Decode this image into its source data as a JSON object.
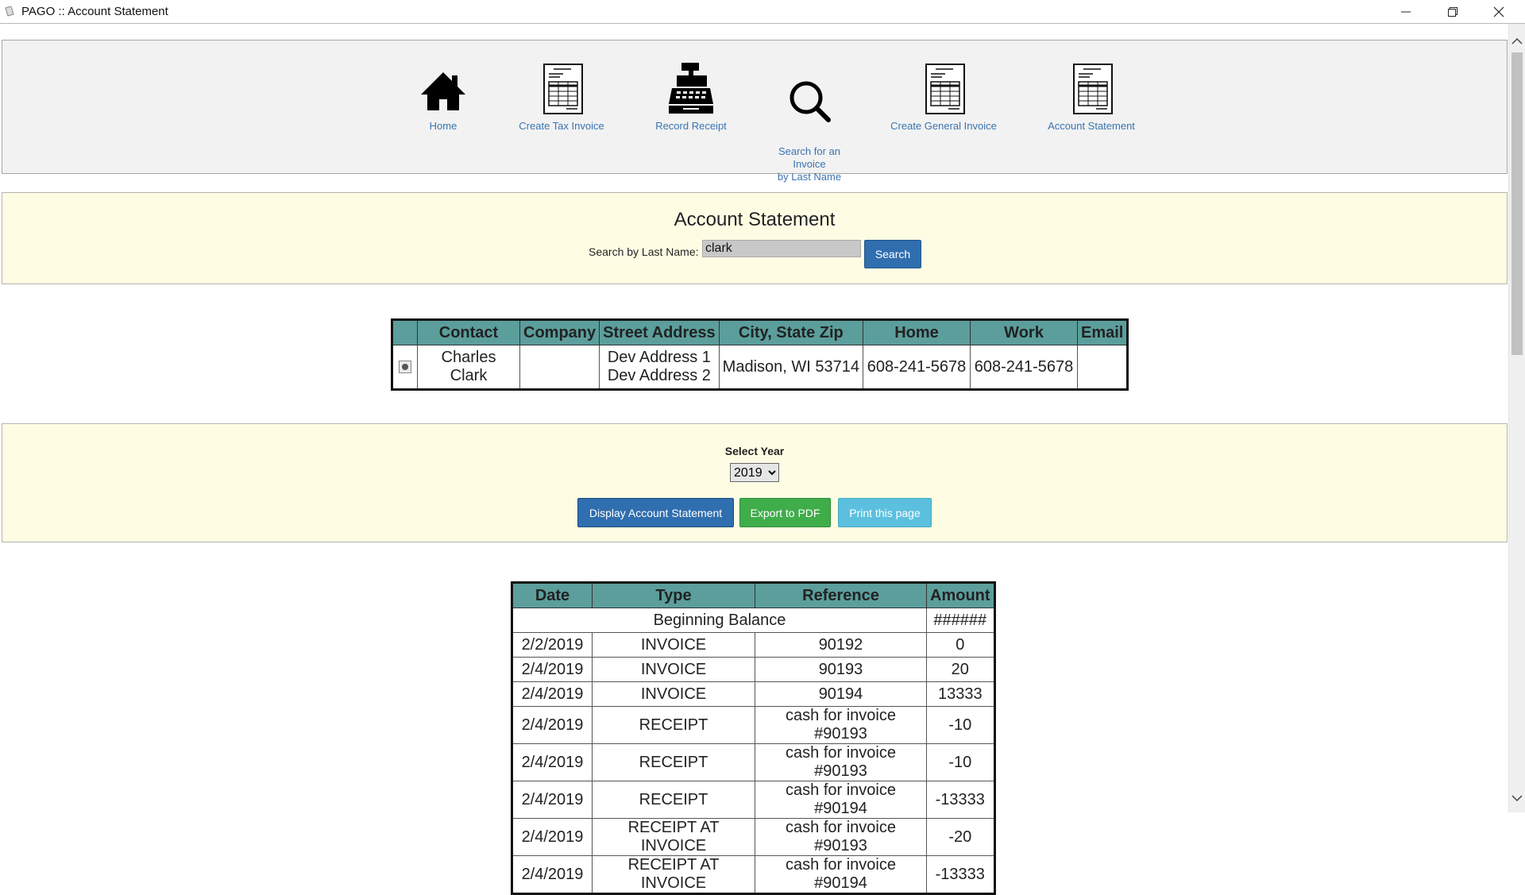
{
  "window": {
    "title": "PAGO :: Account Statement"
  },
  "nav": {
    "items": [
      {
        "label": "Home",
        "icon": "home-icon"
      },
      {
        "label": "Create Tax Invoice",
        "icon": "invoice-icon"
      },
      {
        "label": "Record Receipt",
        "icon": "cash-register-icon"
      },
      {
        "label": "Search for an\nInvoice\nby Last Name",
        "icon": "search-icon"
      },
      {
        "label": "Create General Invoice",
        "icon": "invoice-icon"
      },
      {
        "label": "Account Statement",
        "icon": "invoice-icon"
      }
    ]
  },
  "search": {
    "title": "Account Statement",
    "label": "Search by Last Name:",
    "value": "clark",
    "button": "Search"
  },
  "contacts": {
    "headers": [
      "Contact",
      "Company",
      "Street Address",
      "City, State Zip",
      "Home",
      "Work",
      "Email"
    ],
    "rows": [
      {
        "contact": "Charles Clark",
        "company": "",
        "street1": "Dev Address 1",
        "street2": "Dev Address 2",
        "city": "Madison, WI 53714",
        "home": "608-241-5678",
        "work": "608-241-5678",
        "email": ""
      }
    ]
  },
  "year": {
    "label": "Select Year",
    "selected": "2019",
    "display_button": "Display Account Statement",
    "pdf_button": "Export to PDF",
    "print_button": "Print this page"
  },
  "statement": {
    "headers": [
      "Date",
      "Type",
      "Reference",
      "Amount"
    ],
    "beginning_label": "Beginning Balance",
    "beginning_amount": "######",
    "rows": [
      {
        "date": "2/2/2019",
        "type": "INVOICE",
        "reference": "90192",
        "amount": "0"
      },
      {
        "date": "2/4/2019",
        "type": "INVOICE",
        "reference": "90193",
        "amount": "20"
      },
      {
        "date": "2/4/2019",
        "type": "INVOICE",
        "reference": "90194",
        "amount": "13333"
      },
      {
        "date": "2/4/2019",
        "type": "RECEIPT",
        "reference": "cash for invoice #90193",
        "amount": "-10"
      },
      {
        "date": "2/4/2019",
        "type": "RECEIPT",
        "reference": "cash for invoice #90193",
        "amount": "-10"
      },
      {
        "date": "2/4/2019",
        "type": "RECEIPT",
        "reference": "cash for invoice #90194",
        "amount": "-13333"
      },
      {
        "date": "2/4/2019",
        "type": "RECEIPT AT INVOICE",
        "reference": "cash for invoice #90193",
        "amount": "-20"
      },
      {
        "date": "2/4/2019",
        "type": "RECEIPT AT INVOICE",
        "reference": "cash for invoice #90194",
        "amount": "-13333"
      }
    ]
  }
}
